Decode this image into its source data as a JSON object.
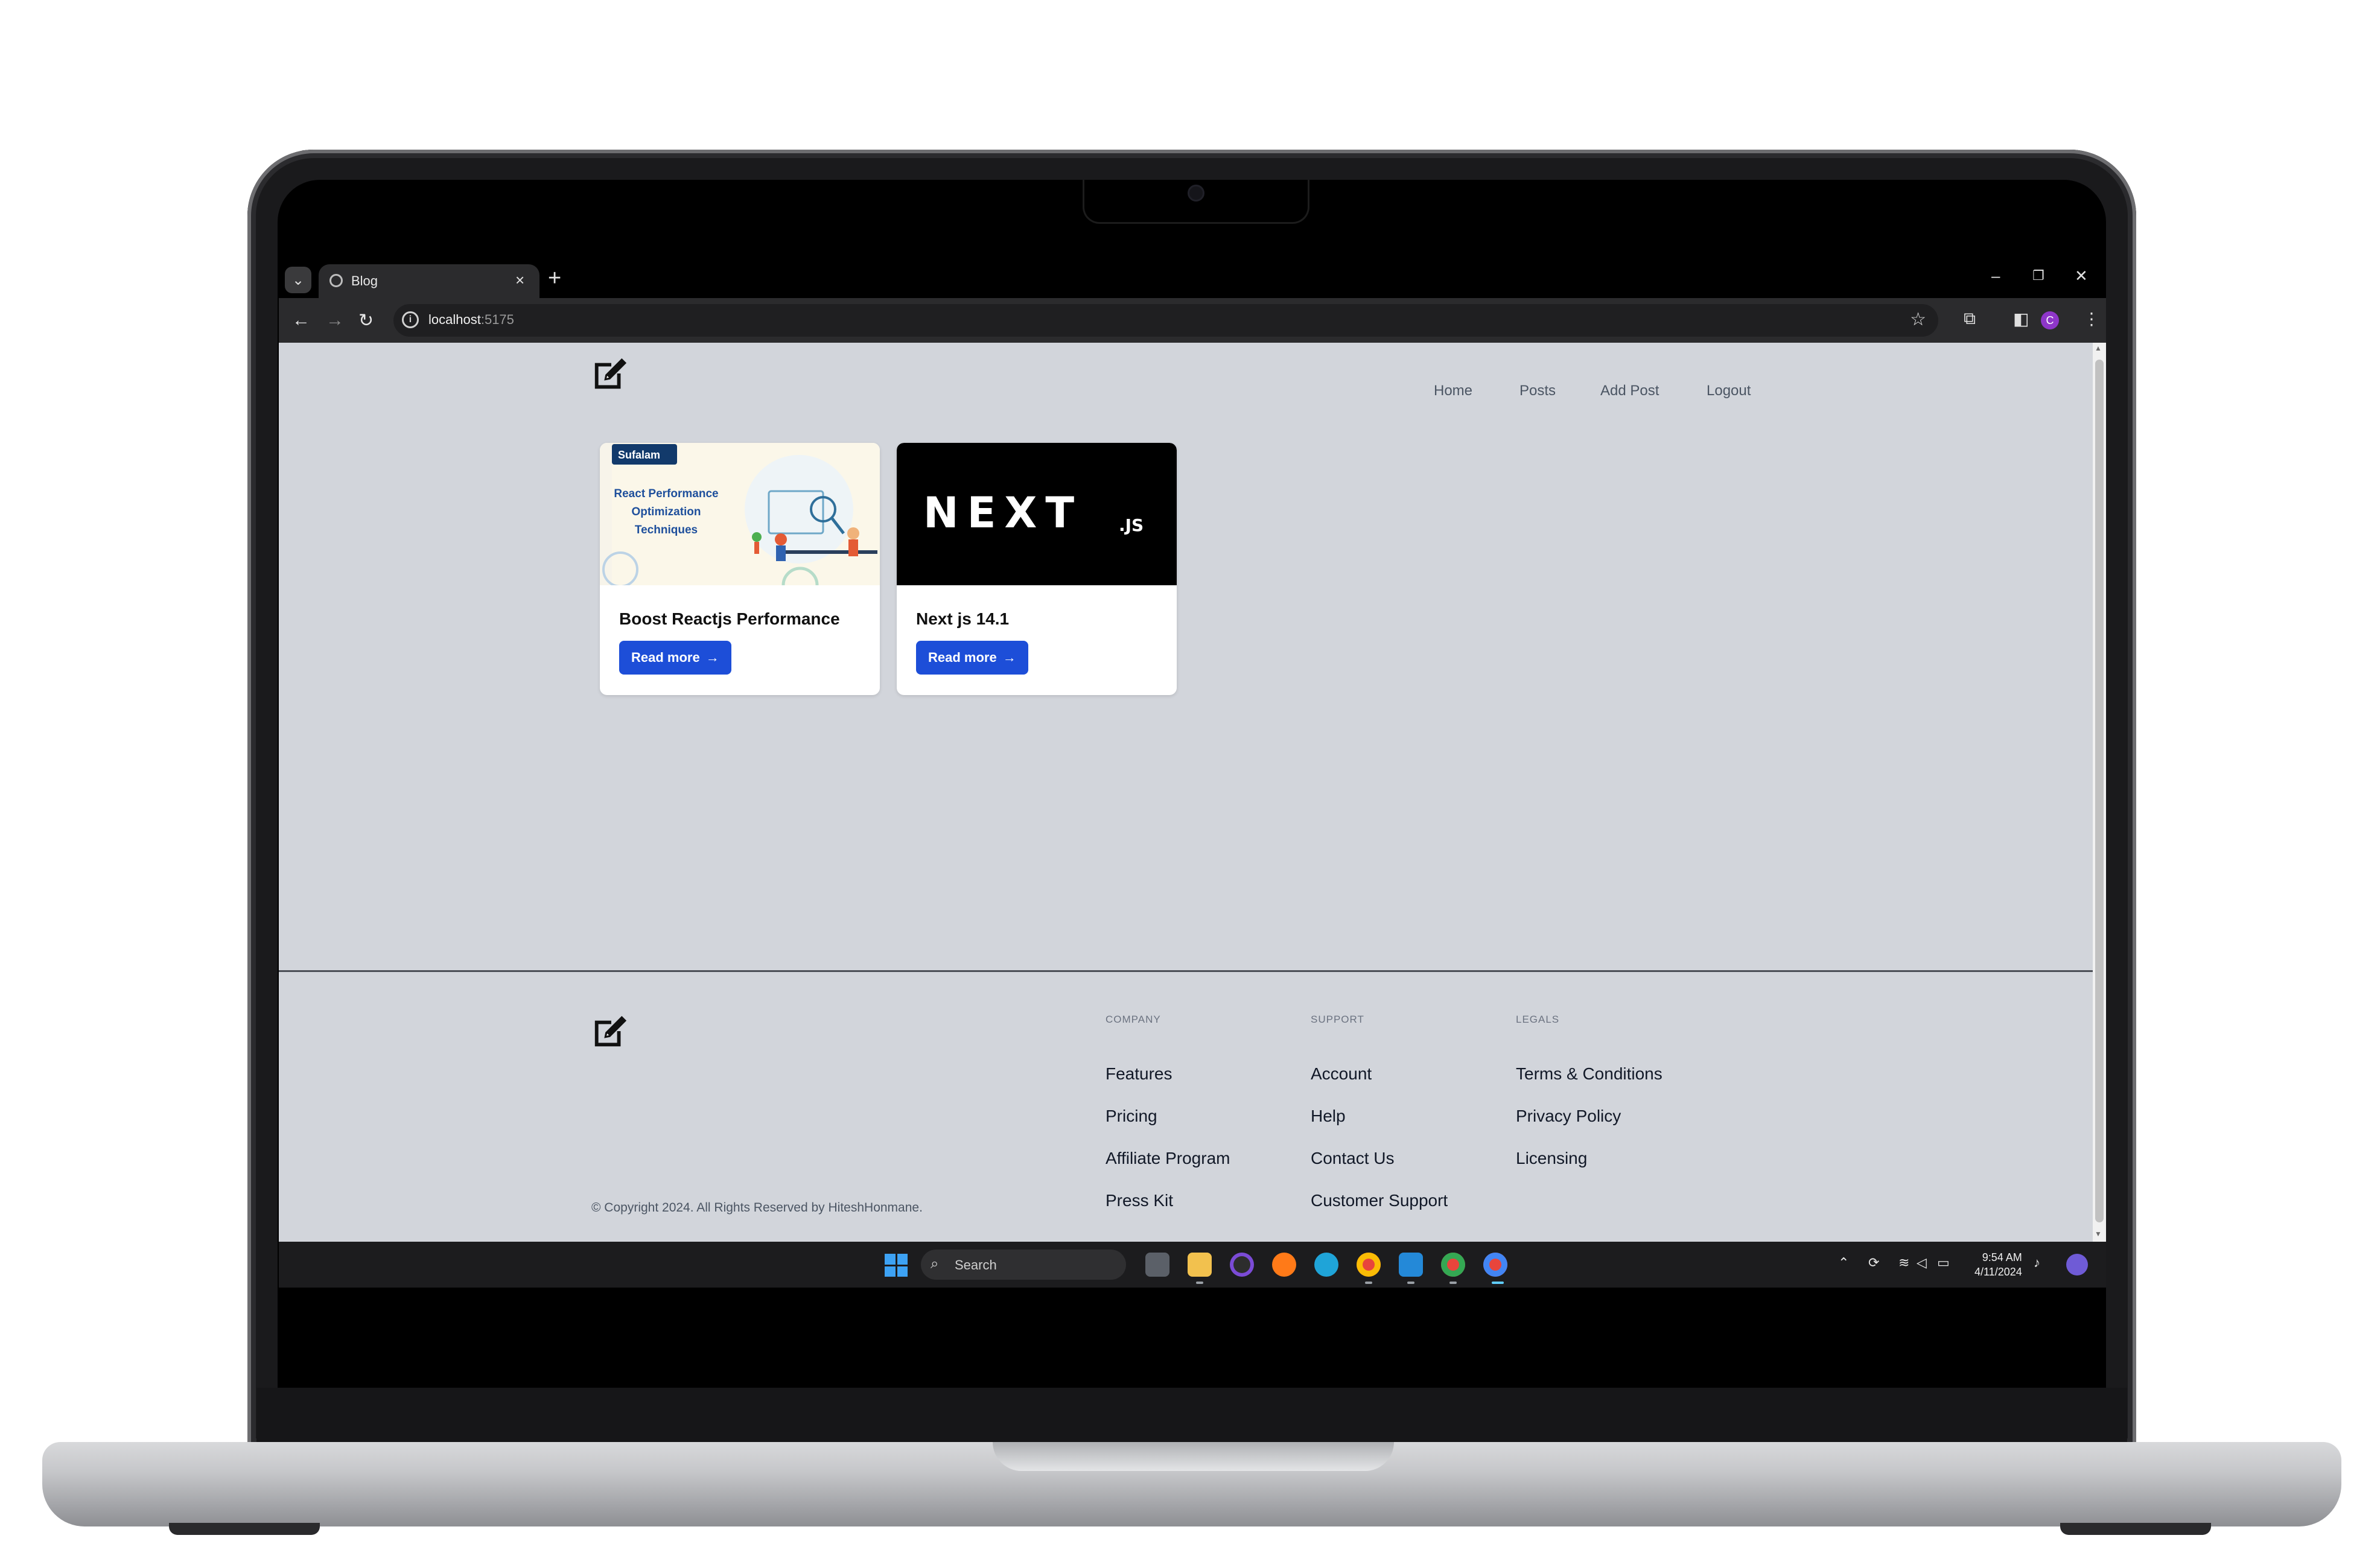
{
  "browser": {
    "tab_title": "Blog",
    "url_host": "localhost",
    "url_port": ":5175",
    "profile_initial": "C"
  },
  "nav": {
    "links": [
      "Home",
      "Posts",
      "Add Post",
      "Logout"
    ]
  },
  "posts": [
    {
      "title": "Boost Reactjs Performance",
      "button": "Read more",
      "image": {
        "brand": "Sufalam",
        "headline_lines": [
          "React Performance",
          "Optimization",
          "Techniques"
        ]
      }
    },
    {
      "title": "Next js 14.1",
      "button": "Read more",
      "image": {
        "logo_main": "NEXT",
        "logo_suffix": ".JS"
      }
    }
  ],
  "footer": {
    "columns": [
      {
        "heading": "COMPANY",
        "links": [
          "Features",
          "Pricing",
          "Affiliate Program",
          "Press Kit"
        ]
      },
      {
        "heading": "SUPPORT",
        "links": [
          "Account",
          "Help",
          "Contact Us",
          "Customer Support"
        ]
      },
      {
        "heading": "LEGALS",
        "links": [
          "Terms & Conditions",
          "Privacy Policy",
          "Licensing"
        ]
      }
    ],
    "copyright": "© Copyright 2024. All Rights Reserved by HiteshHonmane."
  },
  "taskbar": {
    "search_placeholder": "Search",
    "time": "9:54 AM",
    "date": "4/11/2024"
  },
  "colors": {
    "page_bg": "#d2d5db",
    "button_bg": "#1d4ed8",
    "browser_chrome": "#2b2b2d"
  }
}
